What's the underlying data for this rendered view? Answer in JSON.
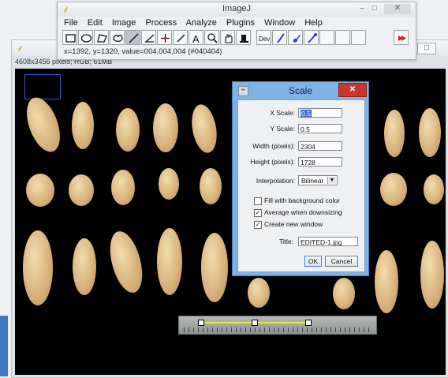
{
  "main_window": {
    "title": "ImageJ",
    "icon": "microscope-icon",
    "menus": [
      "File",
      "Edit",
      "Image",
      "Process",
      "Analyze",
      "Plugins",
      "Window",
      "Help"
    ],
    "tools": [
      "rectangle-tool-icon",
      "oval-tool-icon",
      "polygon-tool-icon",
      "freehand-tool-icon",
      "straight-line-tool-icon",
      "angle-tool-icon",
      "point-tool-icon",
      "wand-tool-icon",
      "text-tool-icon",
      "magnifier-tool-icon",
      "scroll-tool-icon",
      "color-picker-tool-icon",
      "developer-menu-icon",
      "pencil-tool-icon",
      "brush-tool-icon",
      "dropper-tool-icon",
      "blank-tool-1",
      "blank-tool-2",
      "blank-tool-3",
      "more-tools-icon"
    ],
    "dev_label": "Dev",
    "status": "x=1392, y=1320, value=004,004,004 (#040404)"
  },
  "image_window": {
    "info": "4608x3456 pixels; RGB; 61MB",
    "maximize_label": "□"
  },
  "scale_dialog": {
    "title": "Scale",
    "close_label": "✕",
    "x_scale_label": "X Scale:",
    "x_scale_value": "0.5",
    "y_scale_label": "Y Scale:",
    "y_scale_value": "0.5",
    "width_label": "Width (pixels):",
    "width_value": "2304",
    "height_label": "Height (pixels):",
    "height_value": "1728",
    "interpolation_label": "Interpolation:",
    "interpolation_value": "Bilinear",
    "checkboxes": [
      {
        "label": "Fill with background color",
        "checked": false
      },
      {
        "label": "Average when downsizing",
        "checked": true
      },
      {
        "label": "Create new window",
        "checked": true
      }
    ],
    "title_label": "Title:",
    "title_value": "EDITED-1.jpg",
    "ok_label": "OK",
    "cancel_label": "Cancel"
  },
  "colors": {
    "dialog_frame": "#7fb3e4",
    "close_button": "#c9372c",
    "selection_box": "#3f54c8",
    "measure_line": "#e8e83a"
  }
}
